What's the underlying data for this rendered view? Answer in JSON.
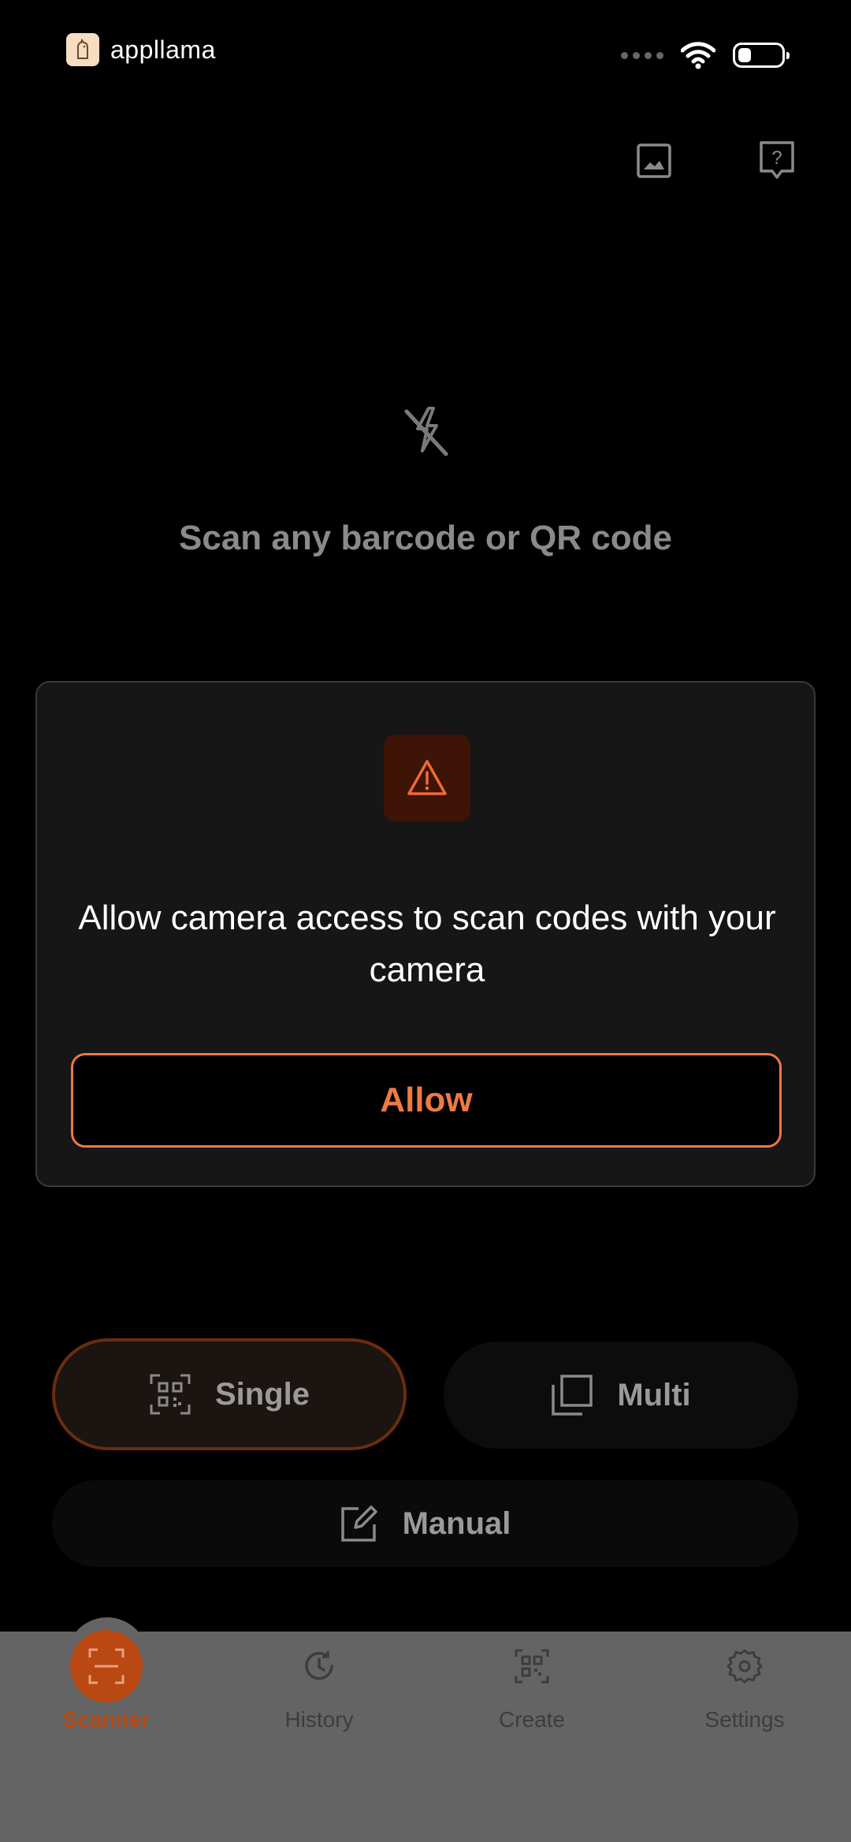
{
  "status_bar": {
    "app_name": "appllama"
  },
  "header": {
    "gallery_icon": "image-icon",
    "help_icon": "help-icon"
  },
  "main": {
    "flash_icon": "flash-off-icon",
    "scan_prompt": "Scan any barcode or QR code"
  },
  "dialog": {
    "icon": "warning-icon",
    "message": "Allow camera access to scan codes with your camera",
    "allow_label": "Allow"
  },
  "modes": {
    "single_label": "Single",
    "multi_label": "Multi",
    "manual_label": "Manual"
  },
  "bottom_nav": {
    "items": [
      {
        "label": "Scanner",
        "icon": "scanner-icon",
        "active": true
      },
      {
        "label": "History",
        "icon": "history-icon",
        "active": false
      },
      {
        "label": "Create",
        "icon": "qr-create-icon",
        "active": false
      },
      {
        "label": "Settings",
        "icon": "gear-icon",
        "active": false
      }
    ]
  },
  "colors": {
    "accent": "#EE7A42",
    "nav_active": "#B94812",
    "background": "#000000"
  }
}
